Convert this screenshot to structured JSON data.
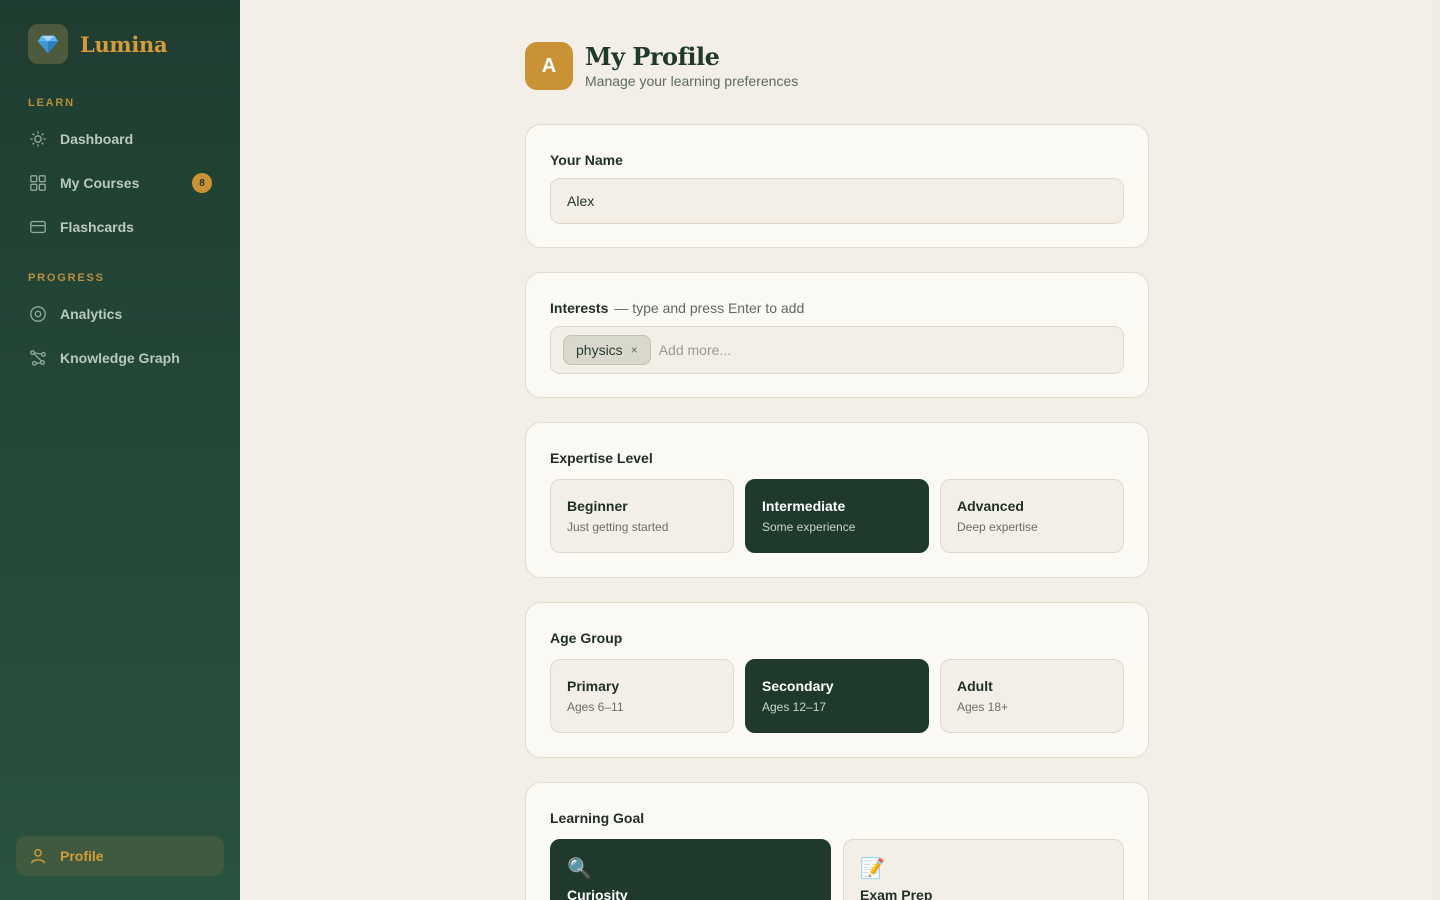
{
  "brand": {
    "name": "Lumina",
    "logo_icon": "gem-icon"
  },
  "sidebar": {
    "sections": [
      {
        "label": "LEARN"
      },
      {
        "label": "PROGRESS"
      }
    ],
    "items": [
      {
        "label": "Dashboard",
        "icon": "sun-icon"
      },
      {
        "label": "My Courses",
        "icon": "grid-icon",
        "badge": "8"
      },
      {
        "label": "Flashcards",
        "icon": "card-icon"
      },
      {
        "label": "Analytics",
        "icon": "target-icon"
      },
      {
        "label": "Knowledge Graph",
        "icon": "graph-icon"
      },
      {
        "label": "Profile",
        "icon": "user-icon",
        "active": true
      }
    ]
  },
  "header": {
    "avatar_letter": "A",
    "title": "My Profile",
    "subtitle": "Manage your learning preferences"
  },
  "name_card": {
    "label": "Your Name",
    "value": "Alex"
  },
  "interests_card": {
    "label": "Interests",
    "hint": "— type and press Enter to add",
    "tags": [
      "physics"
    ],
    "remove_symbol": "×",
    "placeholder": "Add more..."
  },
  "expertise_card": {
    "label": "Expertise Level",
    "options": [
      {
        "title": "Beginner",
        "desc": "Just getting started",
        "selected": false
      },
      {
        "title": "Intermediate",
        "desc": "Some experience",
        "selected": true
      },
      {
        "title": "Advanced",
        "desc": "Deep expertise",
        "selected": false
      }
    ]
  },
  "age_card": {
    "label": "Age Group",
    "options": [
      {
        "title": "Primary",
        "desc": "Ages 6–11",
        "selected": false
      },
      {
        "title": "Secondary",
        "desc": "Ages 12–17",
        "selected": true
      },
      {
        "title": "Adult",
        "desc": "Ages 18+",
        "selected": false
      }
    ]
  },
  "goal_card": {
    "label": "Learning Goal",
    "options": [
      {
        "emoji": "🔍",
        "title": "Curiosity",
        "selected": true
      },
      {
        "emoji": "📝",
        "title": "Exam Prep",
        "selected": false
      }
    ]
  },
  "colors": {
    "sidebar_bg": "#1f3d30",
    "accent_gold": "#c99335",
    "selected_bg": "#1f3a2d",
    "page_bg": "#f3efe6"
  }
}
